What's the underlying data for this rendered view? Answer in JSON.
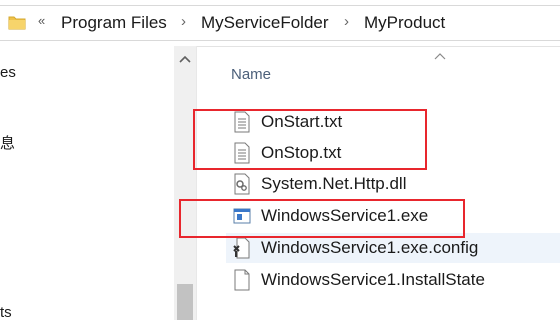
{
  "address_bar": {
    "overflow_glyph": "«",
    "breadcrumbs": [
      {
        "label": "Program Files"
      },
      {
        "label": "MyServiceFolder"
      },
      {
        "label": "MyProduct"
      }
    ],
    "separator_glyph": "›"
  },
  "nav_pane": {
    "items": [
      {
        "label": "es"
      },
      {
        "label": "息"
      },
      {
        "label": "ts"
      }
    ]
  },
  "file_list": {
    "column_header": "Name",
    "files": [
      {
        "name": "OnStart.txt",
        "icon": "text-file-icon"
      },
      {
        "name": "OnStop.txt",
        "icon": "text-file-icon"
      },
      {
        "name": "System.Net.Http.dll",
        "icon": "dll-file-icon"
      },
      {
        "name": "WindowsService1.exe",
        "icon": "exe-app-icon"
      },
      {
        "name": "WindowsService1.exe.config",
        "icon": "config-file-icon"
      },
      {
        "name": "WindowsService1.InstallState",
        "icon": "blank-file-icon"
      }
    ],
    "selected_file": "WindowsService1.exe.config"
  },
  "colors": {
    "highlight": "#e8262d",
    "header_text": "#4c607a",
    "selection": "#eef4fb",
    "folder": "#f0c24a"
  }
}
